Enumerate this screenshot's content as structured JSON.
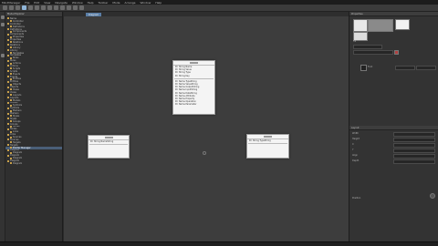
{
  "menubar": {
    "items": [
      "MindManager",
      "File",
      "Edit",
      "View",
      "Navigate",
      "Window",
      "Help",
      "Toolbar",
      "Mode",
      "Arrange",
      "Window",
      "Help"
    ]
  },
  "toolbar": {
    "buttons": [
      "new-icon",
      "open-icon",
      "save-icon",
      "cut-icon",
      "copy-icon",
      "paste-icon",
      "undo-icon",
      "redo-icon",
      "find-icon",
      "run-icon",
      "play-icon",
      "stop-icon",
      "zoom-icon"
    ]
  },
  "tree": {
    "header_label": "Model Explorer",
    "items": [
      "Name",
      "Controller",
      "Controller",
      "Definitions",
      "Definitions",
      "Components",
      "Components",
      "Properties",
      "Properties",
      "Relations",
      "Relations",
      "Library",
      "Library",
      "Templates",
      "Templates",
      "Rules",
      "Rules",
      "Actions",
      "Actions",
      "Scripts",
      "Scripts",
      "Events",
      "Events",
      "Entities",
      "Entities",
      "Objects",
      "Objects",
      "Views",
      "Views",
      "Layouts",
      "Layouts",
      "Models",
      "Models",
      "Symbols",
      "Symbols",
      "Markers",
      "Markers",
      "Styles",
      "Styles",
      "Groups",
      "Groups",
      "Nodes",
      "Nodes",
      "Links",
      "Links",
      "Sources",
      "Sources",
      "Targets",
      "Targets",
      "Pointer Manager",
      "Diagram",
      "Diagram",
      "Diagram",
      "Diagram",
      "Diagram",
      "Diagram"
    ],
    "selected_index": 49
  },
  "editor": {
    "tab_label": "Diagram"
  },
  "cards": {
    "top": {
      "rows_a": [
        "ID: String Name",
        "ID: String Value",
        "ID: String Type",
        "ID: String Key"
      ],
      "rows_b": [
        "ID: Name TypeString",
        "ID: Name ValueString",
        "ID: Name OutputString",
        "ID: Name InputString",
        "ID: Name DataString",
        "ID: Name Attribute",
        "ID: Name Property",
        "ID: Name Operation",
        "ID: Name Parameter"
      ]
    },
    "left": {
      "rows": [
        "ID: String NameString"
      ]
    },
    "right": {
      "rows": [
        "ID: String TypeString"
      ]
    }
  },
  "inspector": {
    "header_label": "Properties",
    "section_label": "Fill",
    "font_label": "Font",
    "lower_header": "Layout",
    "props": [
      "Width",
      "Height",
      "X",
      "Y",
      "Align",
      "Depth"
    ],
    "footer_label": "Position"
  }
}
